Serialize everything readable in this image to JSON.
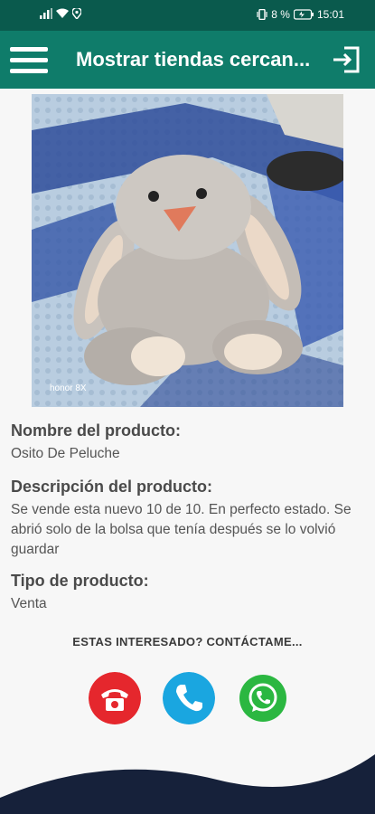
{
  "status_bar": {
    "battery_percent": "8 %",
    "time": "15:01"
  },
  "app_bar": {
    "title": "Mostrar tiendas cercan...",
    "menu_icon": "hamburger-menu-icon",
    "exit_icon": "exit-icon"
  },
  "product": {
    "image": "plush-bunny-photo",
    "watermark": "honor 8X",
    "name_label": "Nombre del producto:",
    "name_value": "Osito De Peluche",
    "description_label": "Descripción del producto:",
    "description_value": "Se vende esta nuevo 10 de 10. En perfecto estado. Se abrió solo de la bolsa que tenía después se lo volvió guardar",
    "type_label": "Tipo de producto:",
    "type_value": "Venta"
  },
  "contact": {
    "prompt": "ESTAS INTERESADO? CONTÁCTAME...",
    "buttons": [
      {
        "icon": "telephone-icon",
        "color": "#e5272d"
      },
      {
        "icon": "phone-call-icon",
        "color": "#1aa6e0"
      },
      {
        "icon": "whatsapp-icon",
        "color": "#2bb741"
      }
    ]
  },
  "colors": {
    "app_bar": "#0f7c6a",
    "status_bar": "#0a5a4d",
    "footer_wave": "#16213a"
  }
}
